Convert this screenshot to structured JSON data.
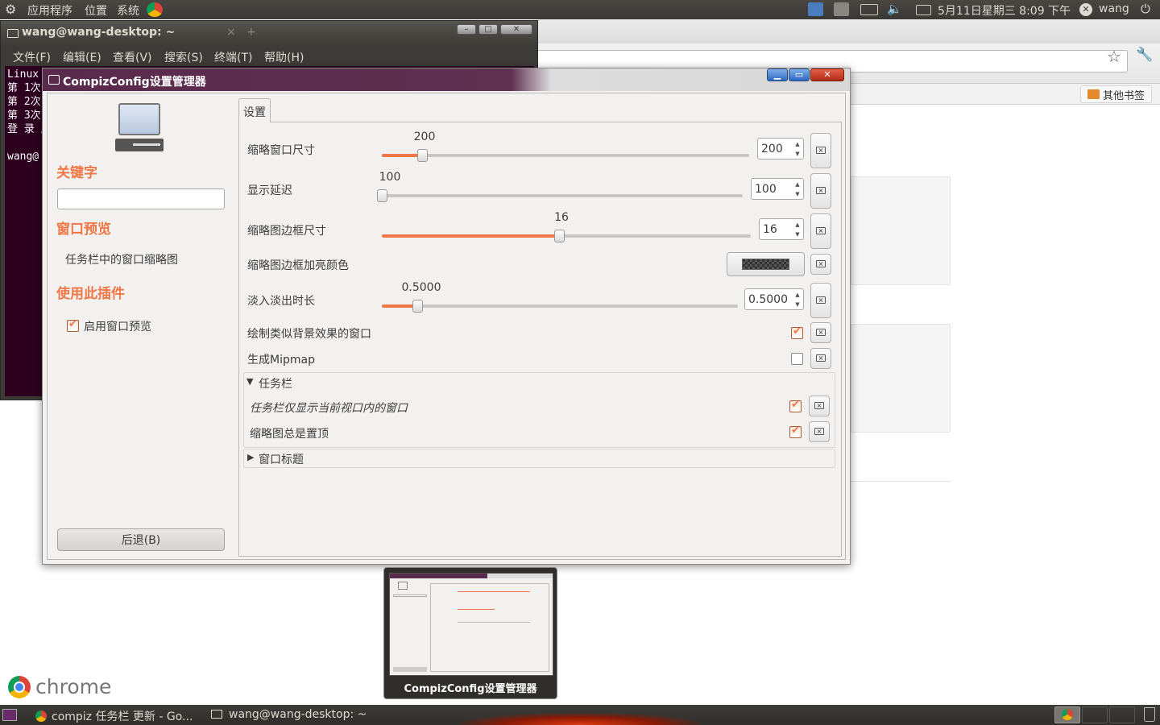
{
  "top_panel": {
    "menus": [
      "应用程序",
      "位置",
      "系统"
    ],
    "datetime": "5月11日星期三  8:09 下午",
    "user": "wang"
  },
  "chrome": {
    "bookmark_other": "其他书签",
    "brand": "chrome"
  },
  "terminal": {
    "title": "wang@wang-desktop: ~",
    "menu": [
      "文件(F)",
      "编辑(E)",
      "查看(V)",
      "搜索(S)",
      "终端(T)",
      "帮助(H)"
    ],
    "lines": [
      "Linux",
      "第 1次",
      "第 2次",
      "第 3次",
      "登 录 成",
      "",
      "wang@"
    ]
  },
  "compiz": {
    "title": "CompizConfig设置管理器",
    "sidebar": {
      "keyword_heading": "关键字",
      "search_value": "",
      "plugin_heading": "窗口预览",
      "plugin_desc": "任务栏中的窗口缩略图",
      "use_heading": "使用此插件",
      "enable_label": "启用窗口预览",
      "enable_checked": true,
      "back_button": "后退(B)"
    },
    "tab": "设置",
    "settings": {
      "thumb_size": {
        "label": "缩略窗口尺寸",
        "value": "200",
        "level": 0.11
      },
      "show_delay": {
        "label": "显示延迟",
        "value": "100",
        "level": 0.0
      },
      "border_size": {
        "label": "缩略图边框尺寸",
        "value": "16",
        "level": 0.48
      },
      "border_color": {
        "label": "缩略图边框加亮颜色"
      },
      "fade_time": {
        "label": "淡入淡出时长",
        "value": "0.5000",
        "level": 0.1
      },
      "draw_bg": {
        "label": "绘制类似背景效果的窗口",
        "checked": true
      },
      "mipmap": {
        "label": "生成Mipmap",
        "checked": false
      },
      "taskbar_group": {
        "label": "任务栏",
        "expanded": true,
        "current_viewport": {
          "label": "任务栏仅显示当前视口内的窗口",
          "checked": true
        },
        "always_on_top": {
          "label": "缩略图总是置顶",
          "checked": true
        }
      },
      "title_group": {
        "label": "窗口标题",
        "expanded": false
      }
    }
  },
  "taskbar": {
    "tasks": [
      "compiz 任务栏 更新 - Go...",
      "wang@wang-desktop: ~"
    ],
    "preview_label": "CompizConfig设置管理器"
  },
  "colors": {
    "accent": "#f07746",
    "panel": "#3c3b37",
    "terminal_bg": "#2c001e"
  }
}
